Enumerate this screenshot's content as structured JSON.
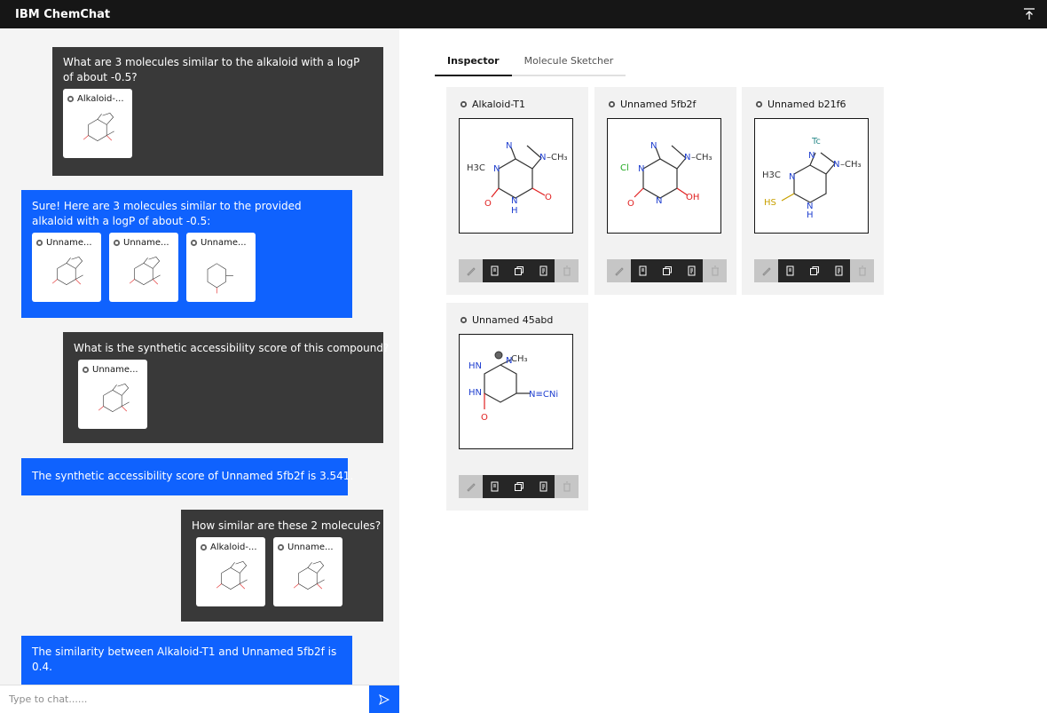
{
  "header": {
    "title": "IBM ChemChat"
  },
  "chat": {
    "messages": [
      {
        "role": "user",
        "text": "What are 3 molecules similar to the alkaloid with a logP of about -0.5?",
        "molecules": [
          "Alkaloid-..."
        ]
      },
      {
        "role": "bot",
        "text": "Sure! Here are 3 molecules similar to the provided alkaloid with a logP of about -0.5:",
        "molecules": [
          "Unname...",
          "Unname...",
          "Unname..."
        ]
      },
      {
        "role": "user",
        "text": "What is the synthetic accessibility score of this compound?",
        "molecules": [
          "Unname..."
        ]
      },
      {
        "role": "bot",
        "text": "The synthetic accessibility score of Unnamed 5fb2f is 3.541.",
        "molecules": []
      },
      {
        "role": "user",
        "text": "How similar are these 2 molecules?",
        "molecules": [
          "Alkaloid-...",
          "Unname..."
        ]
      },
      {
        "role": "bot",
        "text": "The similarity between Alkaloid-T1 and Unnamed 5fb2f is 0.4.",
        "molecules": []
      }
    ],
    "input_placeholder": "Type to chat......"
  },
  "inspector": {
    "tabs": [
      {
        "label": "Inspector",
        "active": true
      },
      {
        "label": "Molecule Sketcher",
        "active": false
      }
    ],
    "cards": [
      {
        "name": "Alkaloid-T1"
      },
      {
        "name": "Unnamed 5fb2f"
      },
      {
        "name": "Unnamed b21f6"
      },
      {
        "name": "Unnamed 45abd"
      }
    ]
  },
  "molecule_labels": {
    "h3c": "H3C",
    "ch3": "CH3",
    "cl": "Cl",
    "oh": "OH",
    "tc": "Tc",
    "hs": "HS",
    "hn": "HN",
    "nc": "N≡CNi",
    "n": "N",
    "h": "H",
    "o": "O"
  },
  "colors": {
    "user_bubble": "#393939",
    "bot_bubble": "#0f62fe",
    "header": "#161616"
  }
}
